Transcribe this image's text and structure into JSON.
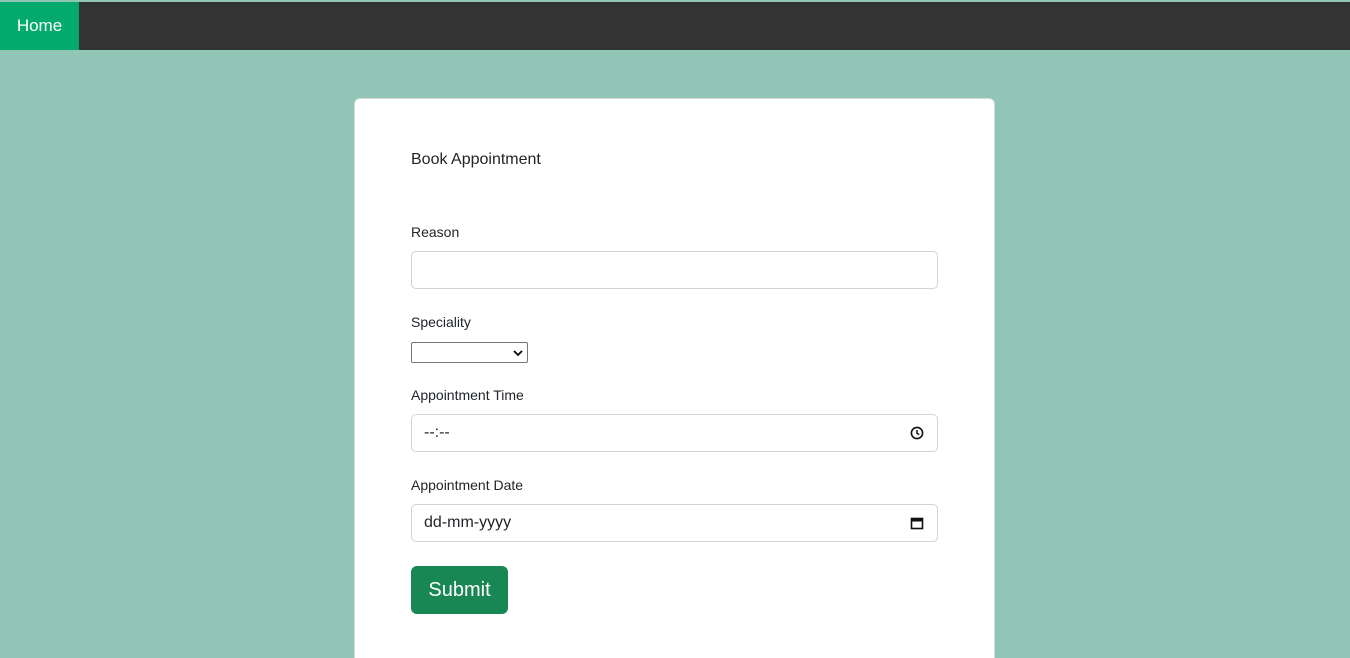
{
  "nav": {
    "home_label": "Home"
  },
  "form": {
    "title": "Book Appointment",
    "reason": {
      "label": "Reason",
      "value": ""
    },
    "speciality": {
      "label": "Speciality",
      "selected": ""
    },
    "time": {
      "label": "Appointment Time",
      "placeholder": "--:--",
      "icon": "clock-icon"
    },
    "date": {
      "label": "Appointment Date",
      "placeholder": "dd-mm-yyyy",
      "icon": "calendar-icon"
    },
    "submit_label": "Submit"
  },
  "colors": {
    "background": "#91c5b6",
    "topbar": "#333333",
    "nav_active": "#04aa6d",
    "submit": "#198754"
  }
}
